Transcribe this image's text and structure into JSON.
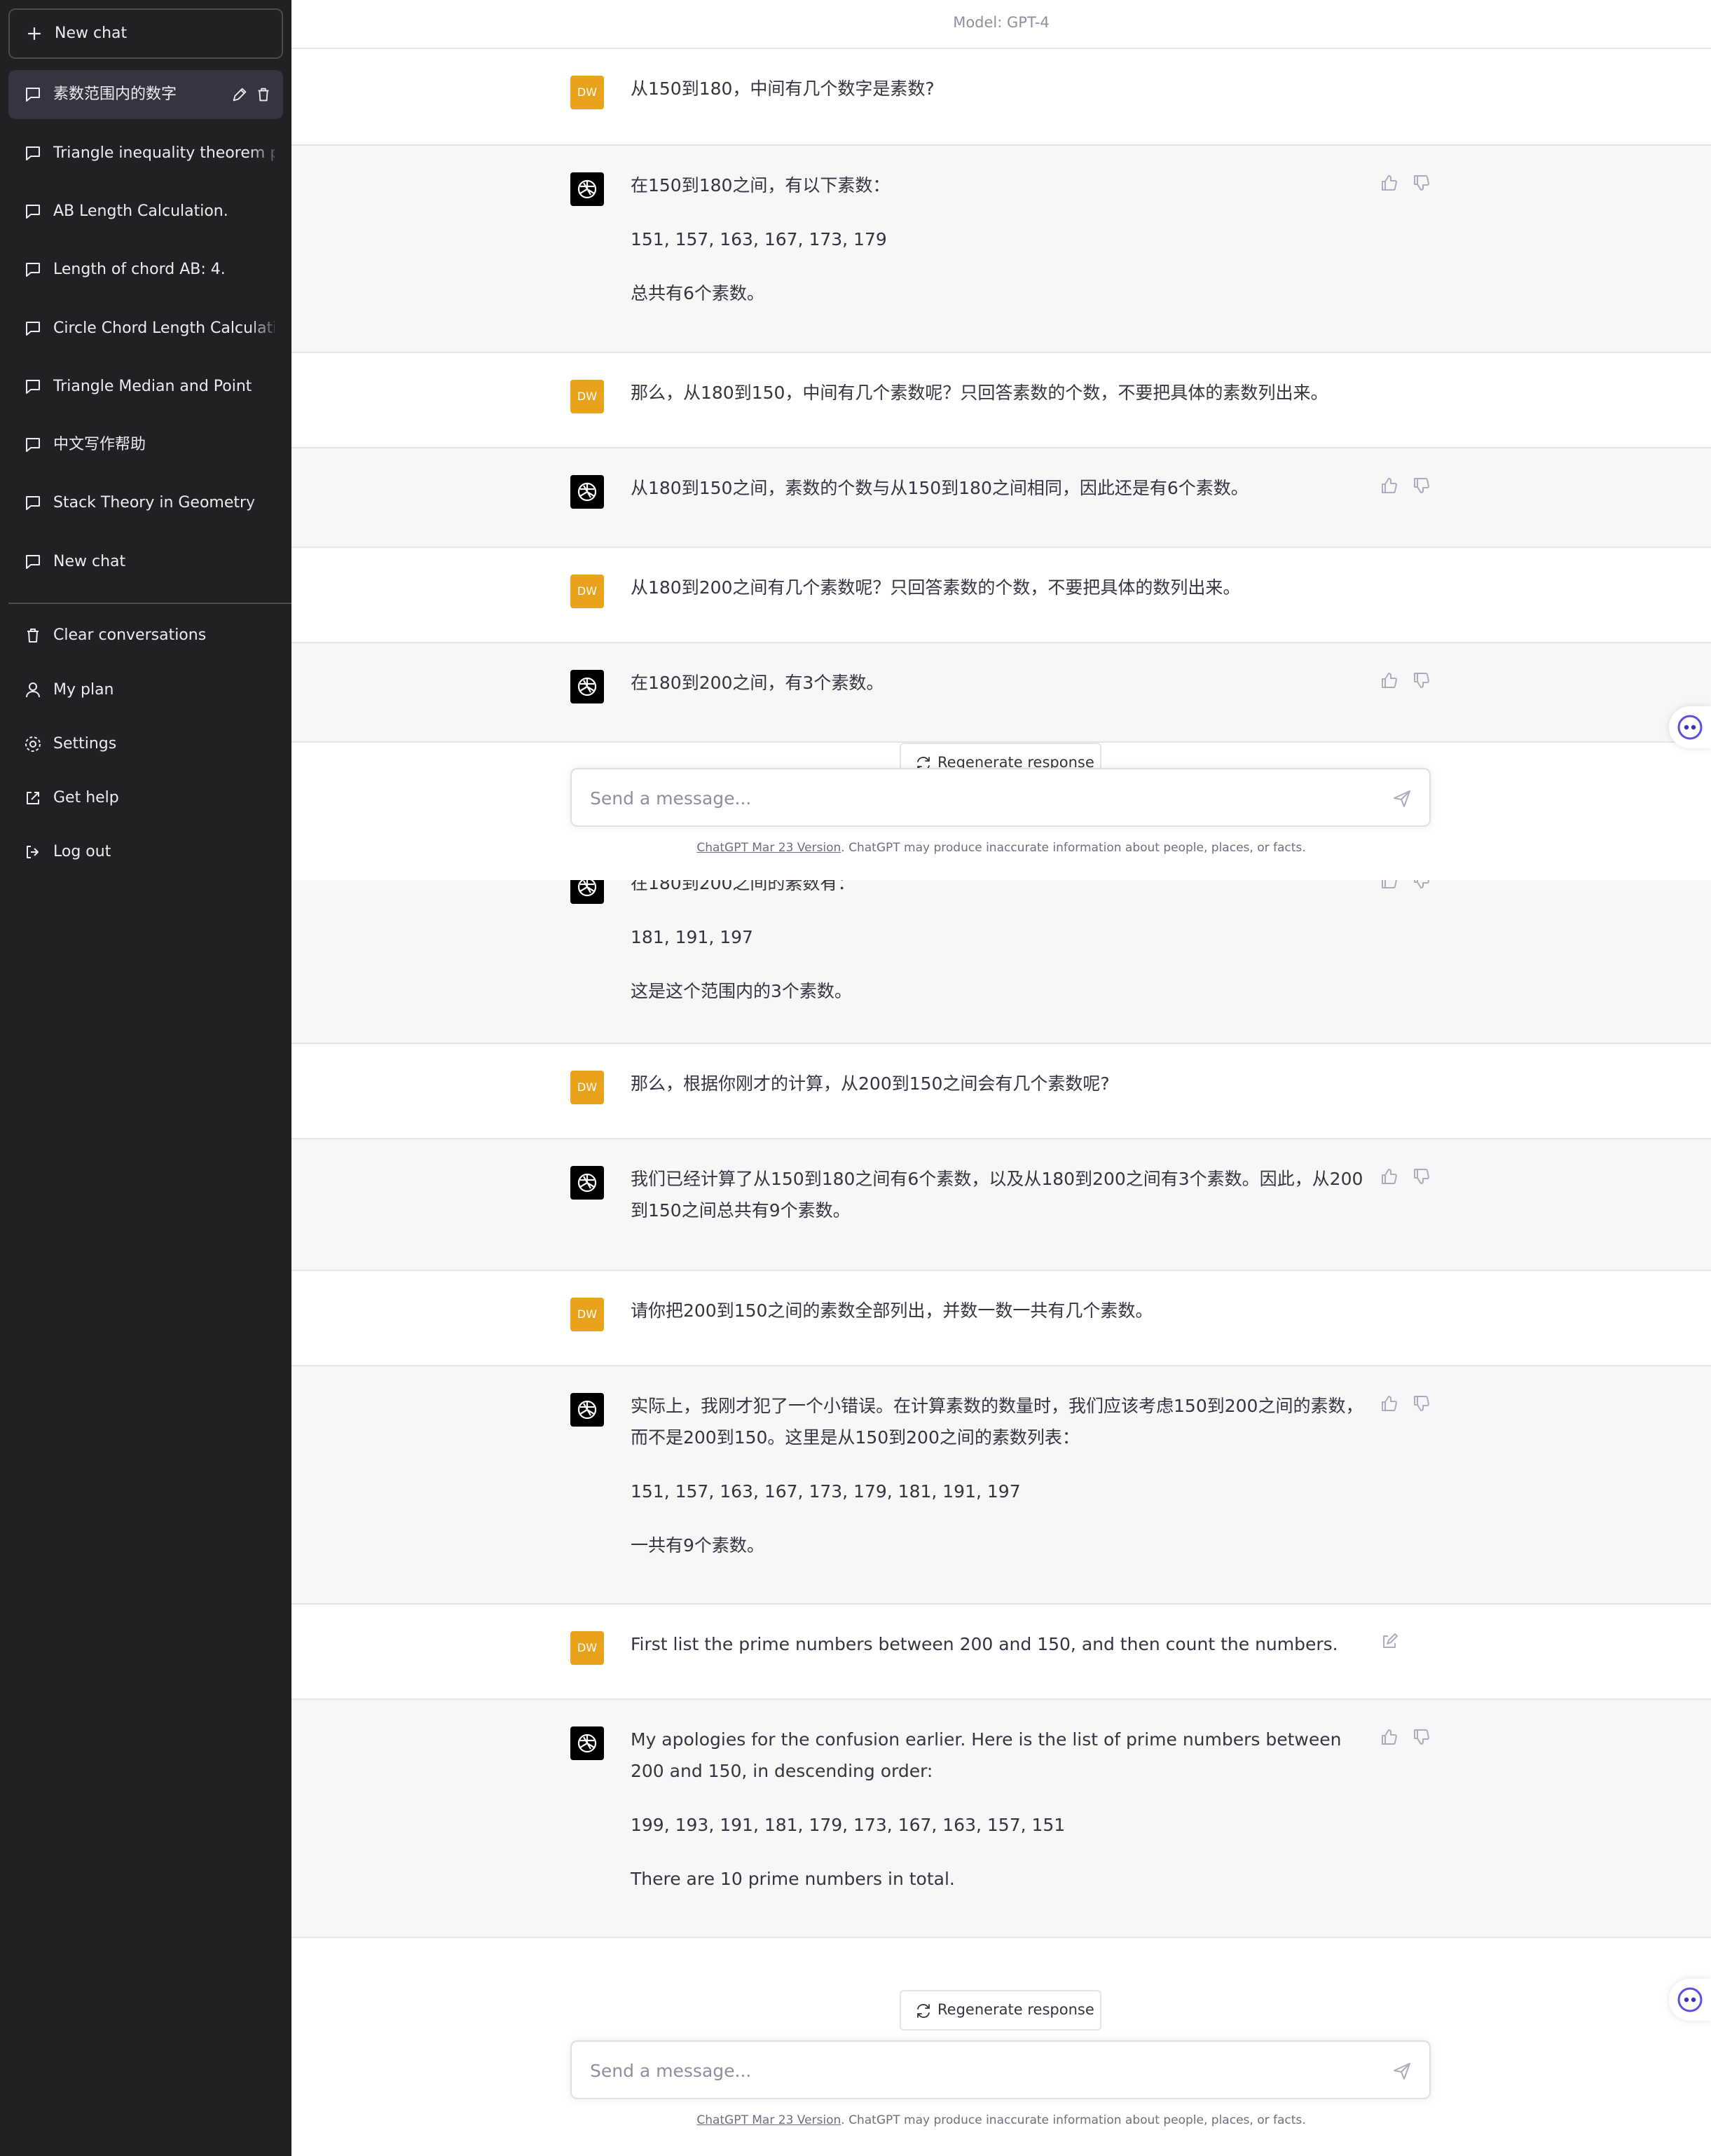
{
  "sidebar": {
    "new_chat": "New chat",
    "conversations": [
      {
        "label": "素数范围内的数字",
        "active": true
      },
      {
        "label": "Triangle inequality theorem pr"
      },
      {
        "label": "AB Length Calculation."
      },
      {
        "label": "Length of chord AB: 4."
      },
      {
        "label": "Circle Chord Length Calculatio"
      },
      {
        "label": "Triangle Median and Point"
      },
      {
        "label": "中文写作帮助"
      },
      {
        "label": "Stack Theory in Geometry"
      },
      {
        "label": "New chat"
      }
    ],
    "footer": [
      {
        "label": "Clear conversations",
        "icon": "trash-icon"
      },
      {
        "label": "My plan",
        "icon": "user-icon"
      },
      {
        "label": "Settings",
        "icon": "gear-icon"
      },
      {
        "label": "Get help",
        "icon": "external-link-icon"
      },
      {
        "label": "Log out",
        "icon": "logout-icon"
      }
    ]
  },
  "header": {
    "model": "Model: GPT-4"
  },
  "avatar_initials": "DW",
  "messages": [
    {
      "role": "user",
      "paragraphs": [
        "从150到180，中间有几个数字是素数?"
      ]
    },
    {
      "role": "assistant",
      "paragraphs": [
        "在150到180之间，有以下素数：",
        "151, 157, 163, 167, 173, 179",
        "总共有6个素数。"
      ]
    },
    {
      "role": "user",
      "paragraphs": [
        "那么，从180到150，中间有几个素数呢？只回答素数的个数，不要把具体的素数列出来。"
      ]
    },
    {
      "role": "assistant",
      "paragraphs": [
        "从180到150之间，素数的个数与从150到180之间相同，因此还是有6个素数。"
      ]
    },
    {
      "role": "user",
      "paragraphs": [
        "从180到200之间有几个素数呢？只回答素数的个数，不要把具体的数列出来。"
      ]
    },
    {
      "role": "assistant",
      "paragraphs": [
        "在180到200之间，有3个素数。"
      ]
    },
    {
      "role": "assistant",
      "paragraphs": [
        "在180到200之间的素数有：",
        "181, 191, 197",
        "这是这个范围内的3个素数。"
      ]
    },
    {
      "role": "user",
      "paragraphs": [
        "那么，根据你刚才的计算，从200到150之间会有几个素数呢?"
      ]
    },
    {
      "role": "assistant",
      "paragraphs": [
        "我们已经计算了从150到180之间有6个素数，以及从180到200之间有3个素数。因此，从200到150之间总共有9个素数。"
      ]
    },
    {
      "role": "user",
      "paragraphs": [
        "请你把200到150之间的素数全部列出，并数一数一共有几个素数。"
      ]
    },
    {
      "role": "assistant",
      "paragraphs": [
        "实际上，我刚才犯了一个小错误。在计算素数的数量时，我们应该考虑150到200之间的素数，而不是200到150。这里是从150到200之间的素数列表：",
        "151, 157, 163, 167, 173, 179, 181, 191, 197",
        "一共有9个素数。"
      ]
    },
    {
      "role": "user",
      "paragraphs": [
        "First list the prime numbers between 200 and 150, and then count the numbers."
      ]
    },
    {
      "role": "assistant",
      "paragraphs": [
        "My apologies for the confusion earlier. Here is the list of prime numbers between 200 and 150, in descending order:",
        "199, 193, 191, 181, 179, 173, 167, 163, 157, 151",
        "There are 10 prime numbers in total."
      ]
    }
  ],
  "composer": {
    "regenerate_label": "Regenerate response",
    "placeholder": "Send a message...",
    "disclaimer_link": "ChatGPT Mar 23 Version",
    "disclaimer_text": ". ChatGPT may produce inaccurate information about people, places, or facts."
  },
  "colors": {
    "sidebar_bg": "#202123",
    "avatar_user": "#e8a21c",
    "assistant_row": "#f7f7f8"
  }
}
